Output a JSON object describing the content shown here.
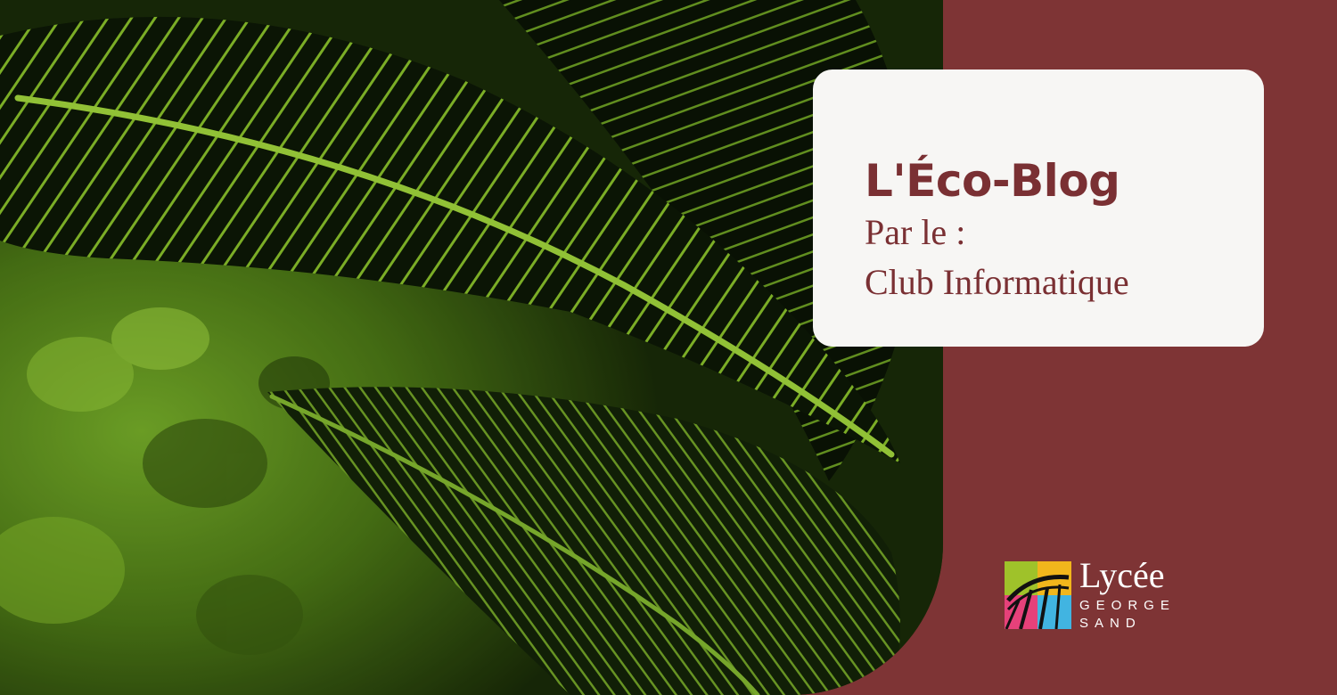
{
  "banner": {
    "background_color": "#7e3435",
    "photo": {
      "subject": "dark striped tropical leaves",
      "colors": {
        "leaf_vein": "#9ed632",
        "leaf_dark": "#0e1a06",
        "backdrop": "#5d8f1c"
      }
    },
    "title_card": {
      "title": "L'Éco-Blog",
      "subtitle_line1": "Par le :",
      "subtitle_line2": "Club Informatique",
      "text_color": "#7a3033",
      "card_color": "#f7f6f4"
    },
    "logo": {
      "word": "Lycée",
      "line2": "GEORGE",
      "line3": "SAND",
      "mark_colors": [
        "#9fc22a",
        "#f1b61c",
        "#e6417a",
        "#41b4e1"
      ]
    }
  }
}
